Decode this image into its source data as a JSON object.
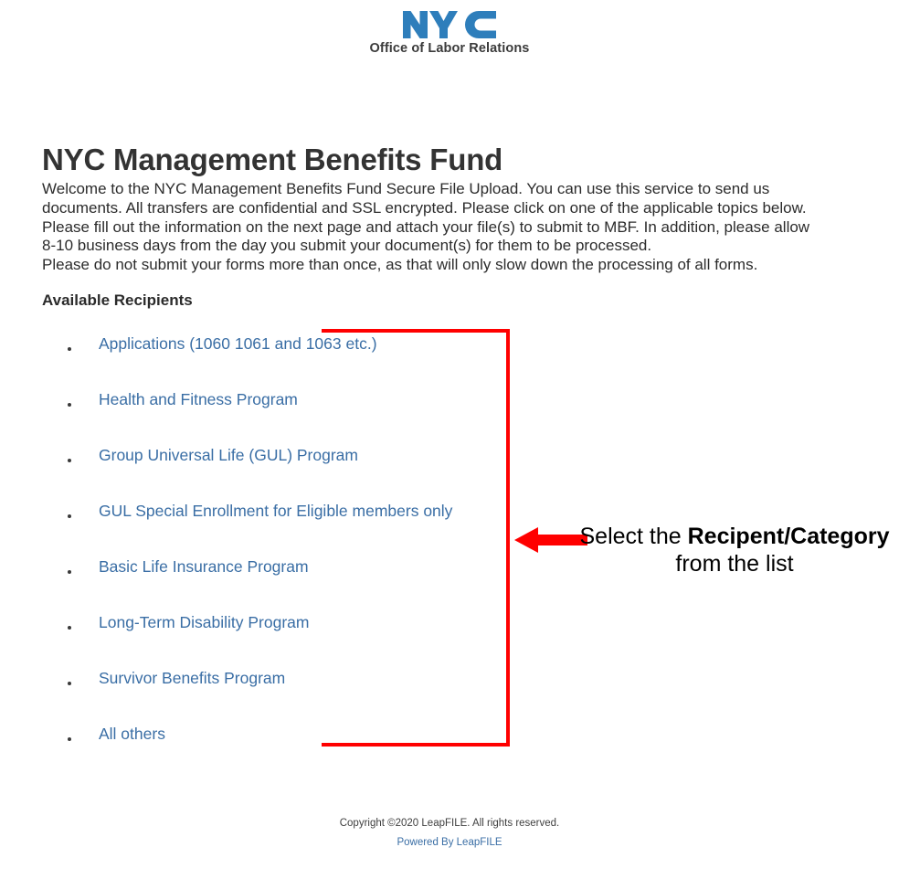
{
  "header": {
    "logo_text": "NYC",
    "logo_subtitle": "Office of Labor Relations",
    "logo_color": "#2e7ebb",
    "logo_icon": "nyc-wordmark-logo"
  },
  "page": {
    "title": "NYC Management Benefits Fund"
  },
  "intro": {
    "line1": "Welcome to the NYC Management Benefits Fund Secure File Upload. You can use this service to send us",
    "line2": "documents. All transfers are confidential and SSL encrypted. Please click on one of the applicable topics below.",
    "line3": "Please fill out the information on the next page and attach your file(s) to submit to MBF. In addition, please allow",
    "line4": "8-10 business days from the day you submit your document(s) for them to be processed.",
    "line5": "Please do not submit your forms more than once, as that will only slow down the processing of all forms."
  },
  "recipients": {
    "heading": "Available Recipients",
    "link_color": "#3a6ea5",
    "items": [
      {
        "label": "Applications (1060 1061 and 1063 etc.)"
      },
      {
        "label": "Health and Fitness Program"
      },
      {
        "label": "Group Universal Life (GUL) Program"
      },
      {
        "label": "GUL Special Enrollment for Eligible members only"
      },
      {
        "label": "Basic Life Insurance Program"
      },
      {
        "label": "Long-Term Disability Program"
      },
      {
        "label": "Survivor Benefits Program"
      },
      {
        "label": "All others"
      }
    ]
  },
  "annotation": {
    "arrow_icon": "left-arrow-icon",
    "arrow_color": "#ff0000",
    "box_color": "#ff0000",
    "caption_lead": "Select the ",
    "caption_emphasis": "Recipent/Category",
    "caption_line2": "from the list"
  },
  "footer": {
    "copyright": "Copyright ©2020 LeapFILE. All rights reserved.",
    "powered_by": "Powered By LeapFILE"
  }
}
